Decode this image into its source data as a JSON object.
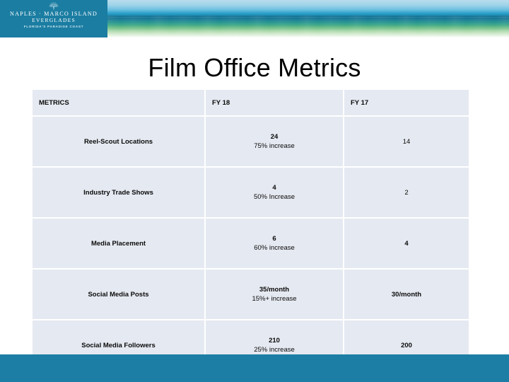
{
  "header": {
    "logo": {
      "icon": "palm-sunburst-icon",
      "line1": "NAPLES · MARCO ISLAND",
      "line2": "EVERGLADES",
      "line3": "FLORIDA'S PARADISE COAST",
      "plate_color": "#1b7da2"
    },
    "banner_image": "beach-ocean-photo"
  },
  "slide": {
    "title": "Film Office Metrics"
  },
  "table": {
    "columns": [
      "METRICS",
      "FY 18",
      "FY 17"
    ],
    "rows": [
      {
        "metric": "Reel-Scout Locations",
        "fy18_primary": "24",
        "fy18_secondary": "75% increase",
        "fy17": "14",
        "fy17_bold": false
      },
      {
        "metric": "Industry Trade Shows",
        "fy18_primary": "4",
        "fy18_secondary": "50% Increase",
        "fy17": "2",
        "fy17_bold": false
      },
      {
        "metric": "Media Placement",
        "fy18_primary": "6",
        "fy18_secondary": "60% increase",
        "fy17": "4",
        "fy17_bold": true
      },
      {
        "metric": "Social Media Posts",
        "fy18_primary": "35/month",
        "fy18_secondary": "15%+ increase",
        "fy17": "30/month",
        "fy17_bold": true
      },
      {
        "metric": "Social Media Followers",
        "fy18_primary": "210",
        "fy18_secondary": "25% increase",
        "fy17": "200",
        "fy17_bold": true
      }
    ]
  },
  "footer": {
    "band_color": "#1d7ea5"
  }
}
